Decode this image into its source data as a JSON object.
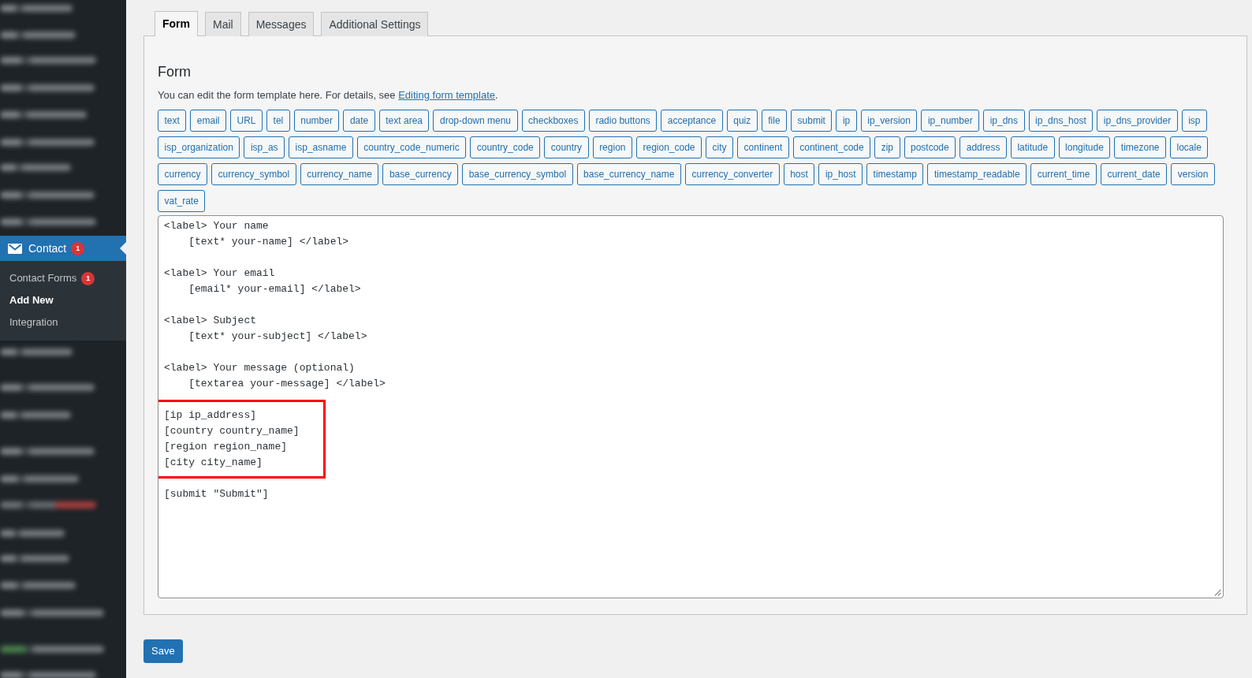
{
  "sidebar": {
    "blurred_items_above": true,
    "menu": {
      "label": "Contact",
      "badge": "1",
      "selected": true
    },
    "submenu": [
      {
        "label": "Contact Forms",
        "badge": "1",
        "selected": false
      },
      {
        "label": "Add New",
        "selected": true
      },
      {
        "label": "Integration",
        "selected": false
      }
    ],
    "blurred_items_below": true
  },
  "tabs": [
    {
      "label": "Form",
      "selected": true
    },
    {
      "label": "Mail",
      "selected": false
    },
    {
      "label": "Messages",
      "selected": false
    },
    {
      "label": "Additional Settings",
      "selected": false
    }
  ],
  "panel": {
    "title": "Form",
    "description": {
      "text": "You can edit the form template here. For details, see",
      "link": "Editing form template",
      "end": "."
    },
    "tag_button_rows": [
      [
        "text",
        "email",
        "URL",
        "tel",
        "number",
        "date",
        "text area",
        "drop-down menu",
        "checkboxes",
        "radio buttons",
        "acceptance",
        "quiz",
        "file",
        "submit",
        "ip",
        "ip_version",
        "ip_number",
        "ip_dns",
        "ip_dns_host",
        "ip_dns_provider",
        "isp"
      ],
      [
        "isp_organization",
        "isp_as",
        "isp_asname",
        "country_code_numeric",
        "country_code",
        "country",
        "region",
        "region_code",
        "city",
        "continent",
        "continent_code",
        "zip",
        "postcode",
        "address",
        "latitude",
        "longitude",
        "timezone",
        "locale"
      ],
      [
        "currency",
        "currency_symbol",
        "currency_name",
        "base_currency",
        "base_currency_symbol",
        "base_currency_name",
        "currency_converter",
        "host",
        "ip_host",
        "timestamp",
        "timestamp_readable",
        "current_time",
        "current_date",
        "version"
      ],
      [
        "vat_rate"
      ]
    ],
    "template": {
      "blocks": [
        {
          "lines": [
            "<label> Your name",
            "    [text* your-name] </label>"
          ],
          "highlighted": false
        },
        {
          "lines": [
            "<label> Your email",
            "    [email* your-email] </label>"
          ],
          "highlighted": false
        },
        {
          "lines": [
            "<label> Subject",
            "    [text* your-subject] </label>"
          ],
          "highlighted": false
        },
        {
          "lines": [
            "<label> Your message (optional)",
            "    [textarea your-message] </label>"
          ],
          "highlighted": false
        },
        {
          "lines": [
            "[ip ip_address]",
            "[country country_name]",
            "[region region_name]",
            "[city city_name]"
          ],
          "highlighted": true
        },
        {
          "lines": [
            "[submit \"Submit\"]"
          ],
          "highlighted": false
        }
      ]
    }
  },
  "save_button": "Save"
}
